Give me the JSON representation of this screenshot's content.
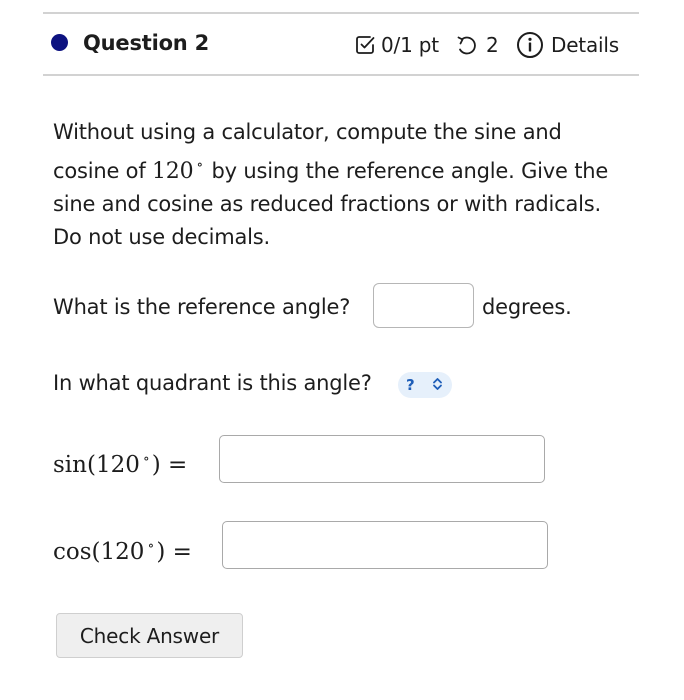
{
  "header": {
    "question_title": "Question 2",
    "score": "0/1 pt",
    "tries": "2",
    "details": "Details",
    "accent_color": "#0d1280"
  },
  "prompt": {
    "text_before": "Without using a calculator, compute the sine and cosine of ",
    "angle": "120",
    "text_after": " by using the reference angle. Give the sine and cosine as reduced fractions or with radicals. Do not use decimals."
  },
  "reference": {
    "question": "What is the reference angle?",
    "value": "",
    "unit": "degrees."
  },
  "quadrant": {
    "question": "In what quadrant is this angle?",
    "selected": "?"
  },
  "sine": {
    "func": "sin",
    "angle": "120",
    "value": ""
  },
  "cosine": {
    "func": "cos",
    "angle": "120",
    "value": ""
  },
  "actions": {
    "check_label": "Check Answer"
  }
}
